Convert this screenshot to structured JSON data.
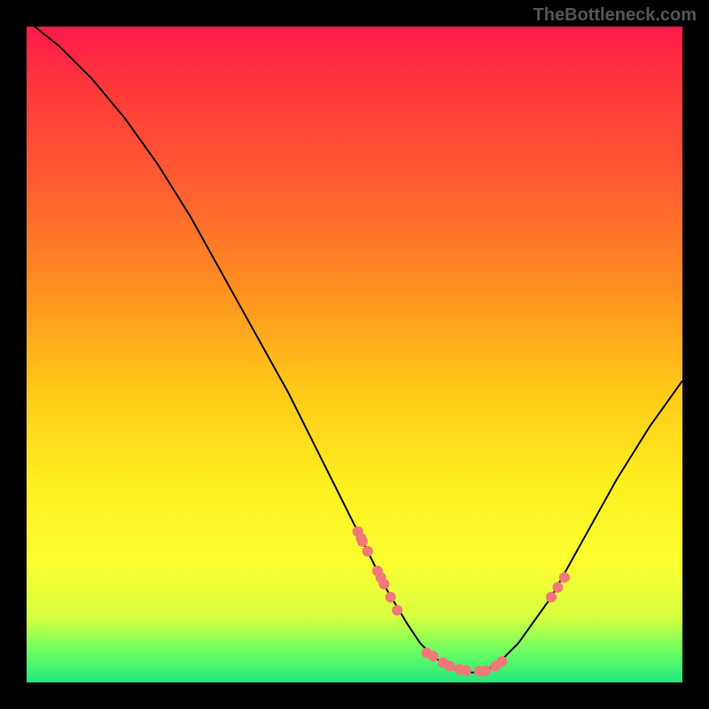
{
  "watermark": "TheBottleneck.com",
  "chart_data": {
    "type": "line",
    "title": "",
    "xlabel": "",
    "ylabel": "",
    "xlim": [
      0,
      100
    ],
    "ylim": [
      0,
      100
    ],
    "curve": {
      "x": [
        0,
        5,
        10,
        15,
        20,
        25,
        30,
        35,
        40,
        45,
        50,
        55,
        58,
        60,
        62,
        64,
        66,
        68,
        70,
        72,
        75,
        80,
        85,
        90,
        95,
        100
      ],
      "y": [
        101,
        97,
        92,
        86,
        79,
        71,
        62,
        53,
        44,
        34,
        24,
        14,
        9,
        6,
        4,
        2.5,
        1.8,
        1.5,
        1.8,
        3,
        6,
        13,
        22,
        31,
        39,
        46
      ]
    },
    "points_left_cluster": [
      {
        "x": 50.5,
        "y": 23
      },
      {
        "x": 51.0,
        "y": 22
      },
      {
        "x": 51.2,
        "y": 21.5
      },
      {
        "x": 52.0,
        "y": 20
      },
      {
        "x": 53.5,
        "y": 17
      },
      {
        "x": 54.0,
        "y": 16
      },
      {
        "x": 54.5,
        "y": 15
      },
      {
        "x": 55.5,
        "y": 13
      },
      {
        "x": 56.5,
        "y": 11
      }
    ],
    "points_bottom_cluster": [
      {
        "x": 61.0,
        "y": 4.5
      },
      {
        "x": 62.0,
        "y": 4
      },
      {
        "x": 63.5,
        "y": 3
      },
      {
        "x": 64.5,
        "y": 2.5
      },
      {
        "x": 66.0,
        "y": 2
      },
      {
        "x": 67.0,
        "y": 1.8
      },
      {
        "x": 69.0,
        "y": 1.7
      },
      {
        "x": 70.0,
        "y": 1.8
      },
      {
        "x": 71.5,
        "y": 2.5
      },
      {
        "x": 72.5,
        "y": 3.2
      }
    ],
    "points_right_cluster": [
      {
        "x": 80.0,
        "y": 13
      },
      {
        "x": 81.0,
        "y": 14.5
      },
      {
        "x": 82.0,
        "y": 16
      }
    ]
  }
}
